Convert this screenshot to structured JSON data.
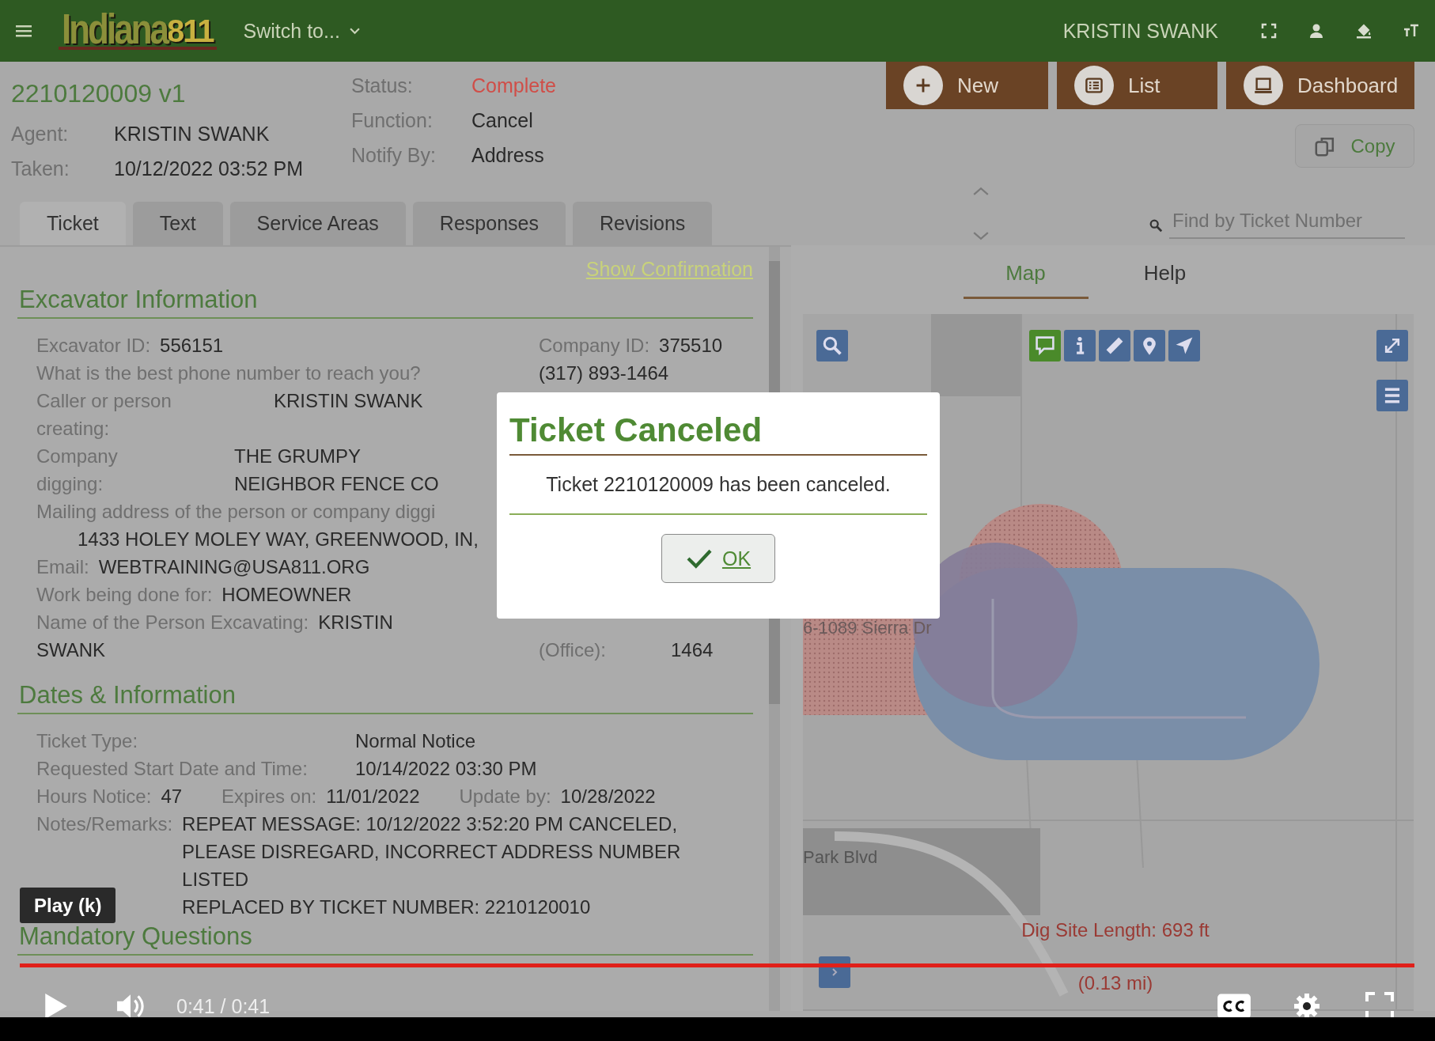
{
  "topbar": {
    "logo_word": "Indiana",
    "logo_number": "811",
    "switcher": "Switch to...",
    "user": "KRISTIN SWANK"
  },
  "ticket": {
    "number": "2210120009 v1",
    "fields_left": [
      {
        "label": "Agent:",
        "value": "KRISTIN SWANK"
      },
      {
        "label": "Taken:",
        "value": "10/12/2022 03:52 PM"
      }
    ],
    "fields_right": [
      {
        "label": "Status:",
        "value": "Complete",
        "kind": "status"
      },
      {
        "label": "Function:",
        "value": "Cancel",
        "kind": "plain"
      },
      {
        "label": "Notify By:",
        "value": "Address",
        "kind": "plain"
      }
    ]
  },
  "actions": [
    {
      "kind": "new",
      "label": "New"
    },
    {
      "kind": "list",
      "label": "List"
    },
    {
      "kind": "dashboard",
      "label": "Dashboard"
    }
  ],
  "copy_button": "Copy",
  "tabs": [
    {
      "label": "Ticket",
      "selected": true
    },
    {
      "label": "Text",
      "selected": false
    },
    {
      "label": "Service Areas",
      "selected": false
    },
    {
      "label": "Responses",
      "selected": false
    },
    {
      "label": "Revisions",
      "selected": false
    }
  ],
  "search": {
    "placeholder": "Find by Ticket Number"
  },
  "show_confirmation": "Show Confirmation",
  "excavator": {
    "title": "Excavator Information",
    "left": [
      {
        "kind": "inline",
        "label": "Excavator ID:",
        "value": "556151"
      },
      {
        "kind": "label",
        "label": "What is the best phone number to reach you?"
      },
      {
        "kind": "wrapped",
        "label": "Caller or person creating:",
        "value": "KRISTIN SWANK"
      },
      {
        "kind": "wrapped",
        "label": "Company digging:",
        "value": "THE GRUMPY NEIGHBOR FENCE CO"
      },
      {
        "kind": "stacked",
        "label": "Mailing address of the person or company diggi",
        "value": "1433 HOLEY MOLEY WAY, GREENWOOD, IN,"
      },
      {
        "kind": "inline",
        "label": "Email:",
        "value": "WEBTRAINING@USA811.ORG"
      },
      {
        "kind": "inline",
        "label": "Work being done for:",
        "value": "HOMEOWNER"
      },
      {
        "kind": "inline",
        "label": "Name of the Person Excavating:",
        "value": "KRISTIN SWANK"
      }
    ],
    "right_top": [
      {
        "kind": "inline",
        "label": "Company ID:",
        "value": "375510"
      },
      {
        "kind": "value",
        "value": "(317) 893-1464"
      }
    ],
    "right_bottom": {
      "label": "(Office):",
      "value": "1464"
    }
  },
  "dates": {
    "title": "Dates & Information",
    "rows": [
      {
        "label": "Ticket Type:",
        "value": "Normal Notice"
      },
      {
        "label": "Requested Start Date and Time:",
        "value": "10/14/2022 03:30 PM"
      }
    ],
    "pairs": [
      {
        "label": "Hours Notice:",
        "value": "47"
      },
      {
        "label": "Expires on:",
        "value": "11/01/2022"
      },
      {
        "label": "Update by:",
        "value": "10/28/2022"
      }
    ],
    "notes": {
      "label": "Notes/Remarks:",
      "lines": [
        "REPEAT MESSAGE: 10/12/2022 3:52:20 PM CANCELED, PLEASE DISREGARD, INCORRECT ADDRESS NUMBER LISTED",
        "REPLACED BY TICKET NUMBER: 2210120010"
      ]
    }
  },
  "mandatory": {
    "title": "Mandatory Questions"
  },
  "map_tabs": [
    {
      "label": "Map",
      "selected": true
    },
    {
      "label": "Help",
      "selected": false
    }
  ],
  "map": {
    "tools": [
      {
        "kind": "comment",
        "selected": true
      },
      {
        "kind": "info",
        "selected": false
      },
      {
        "kind": "measure",
        "selected": false
      },
      {
        "kind": "pin",
        "selected": false
      },
      {
        "kind": "navigate",
        "selected": false
      }
    ],
    "street_labels": [
      "6-1089  Sierra Dr",
      "Park Blvd"
    ],
    "dig_length": "Dig Site Length: 693 ft",
    "dig_length_mi": "(0.13 mi)"
  },
  "dialog": {
    "title": "Ticket Canceled",
    "message": "Ticket 2210120009 has been canceled.",
    "ok": "OK"
  },
  "video": {
    "tooltip": "Play (k)",
    "time": "0:41 / 0:41",
    "progress": {
      "level": 1
    }
  }
}
